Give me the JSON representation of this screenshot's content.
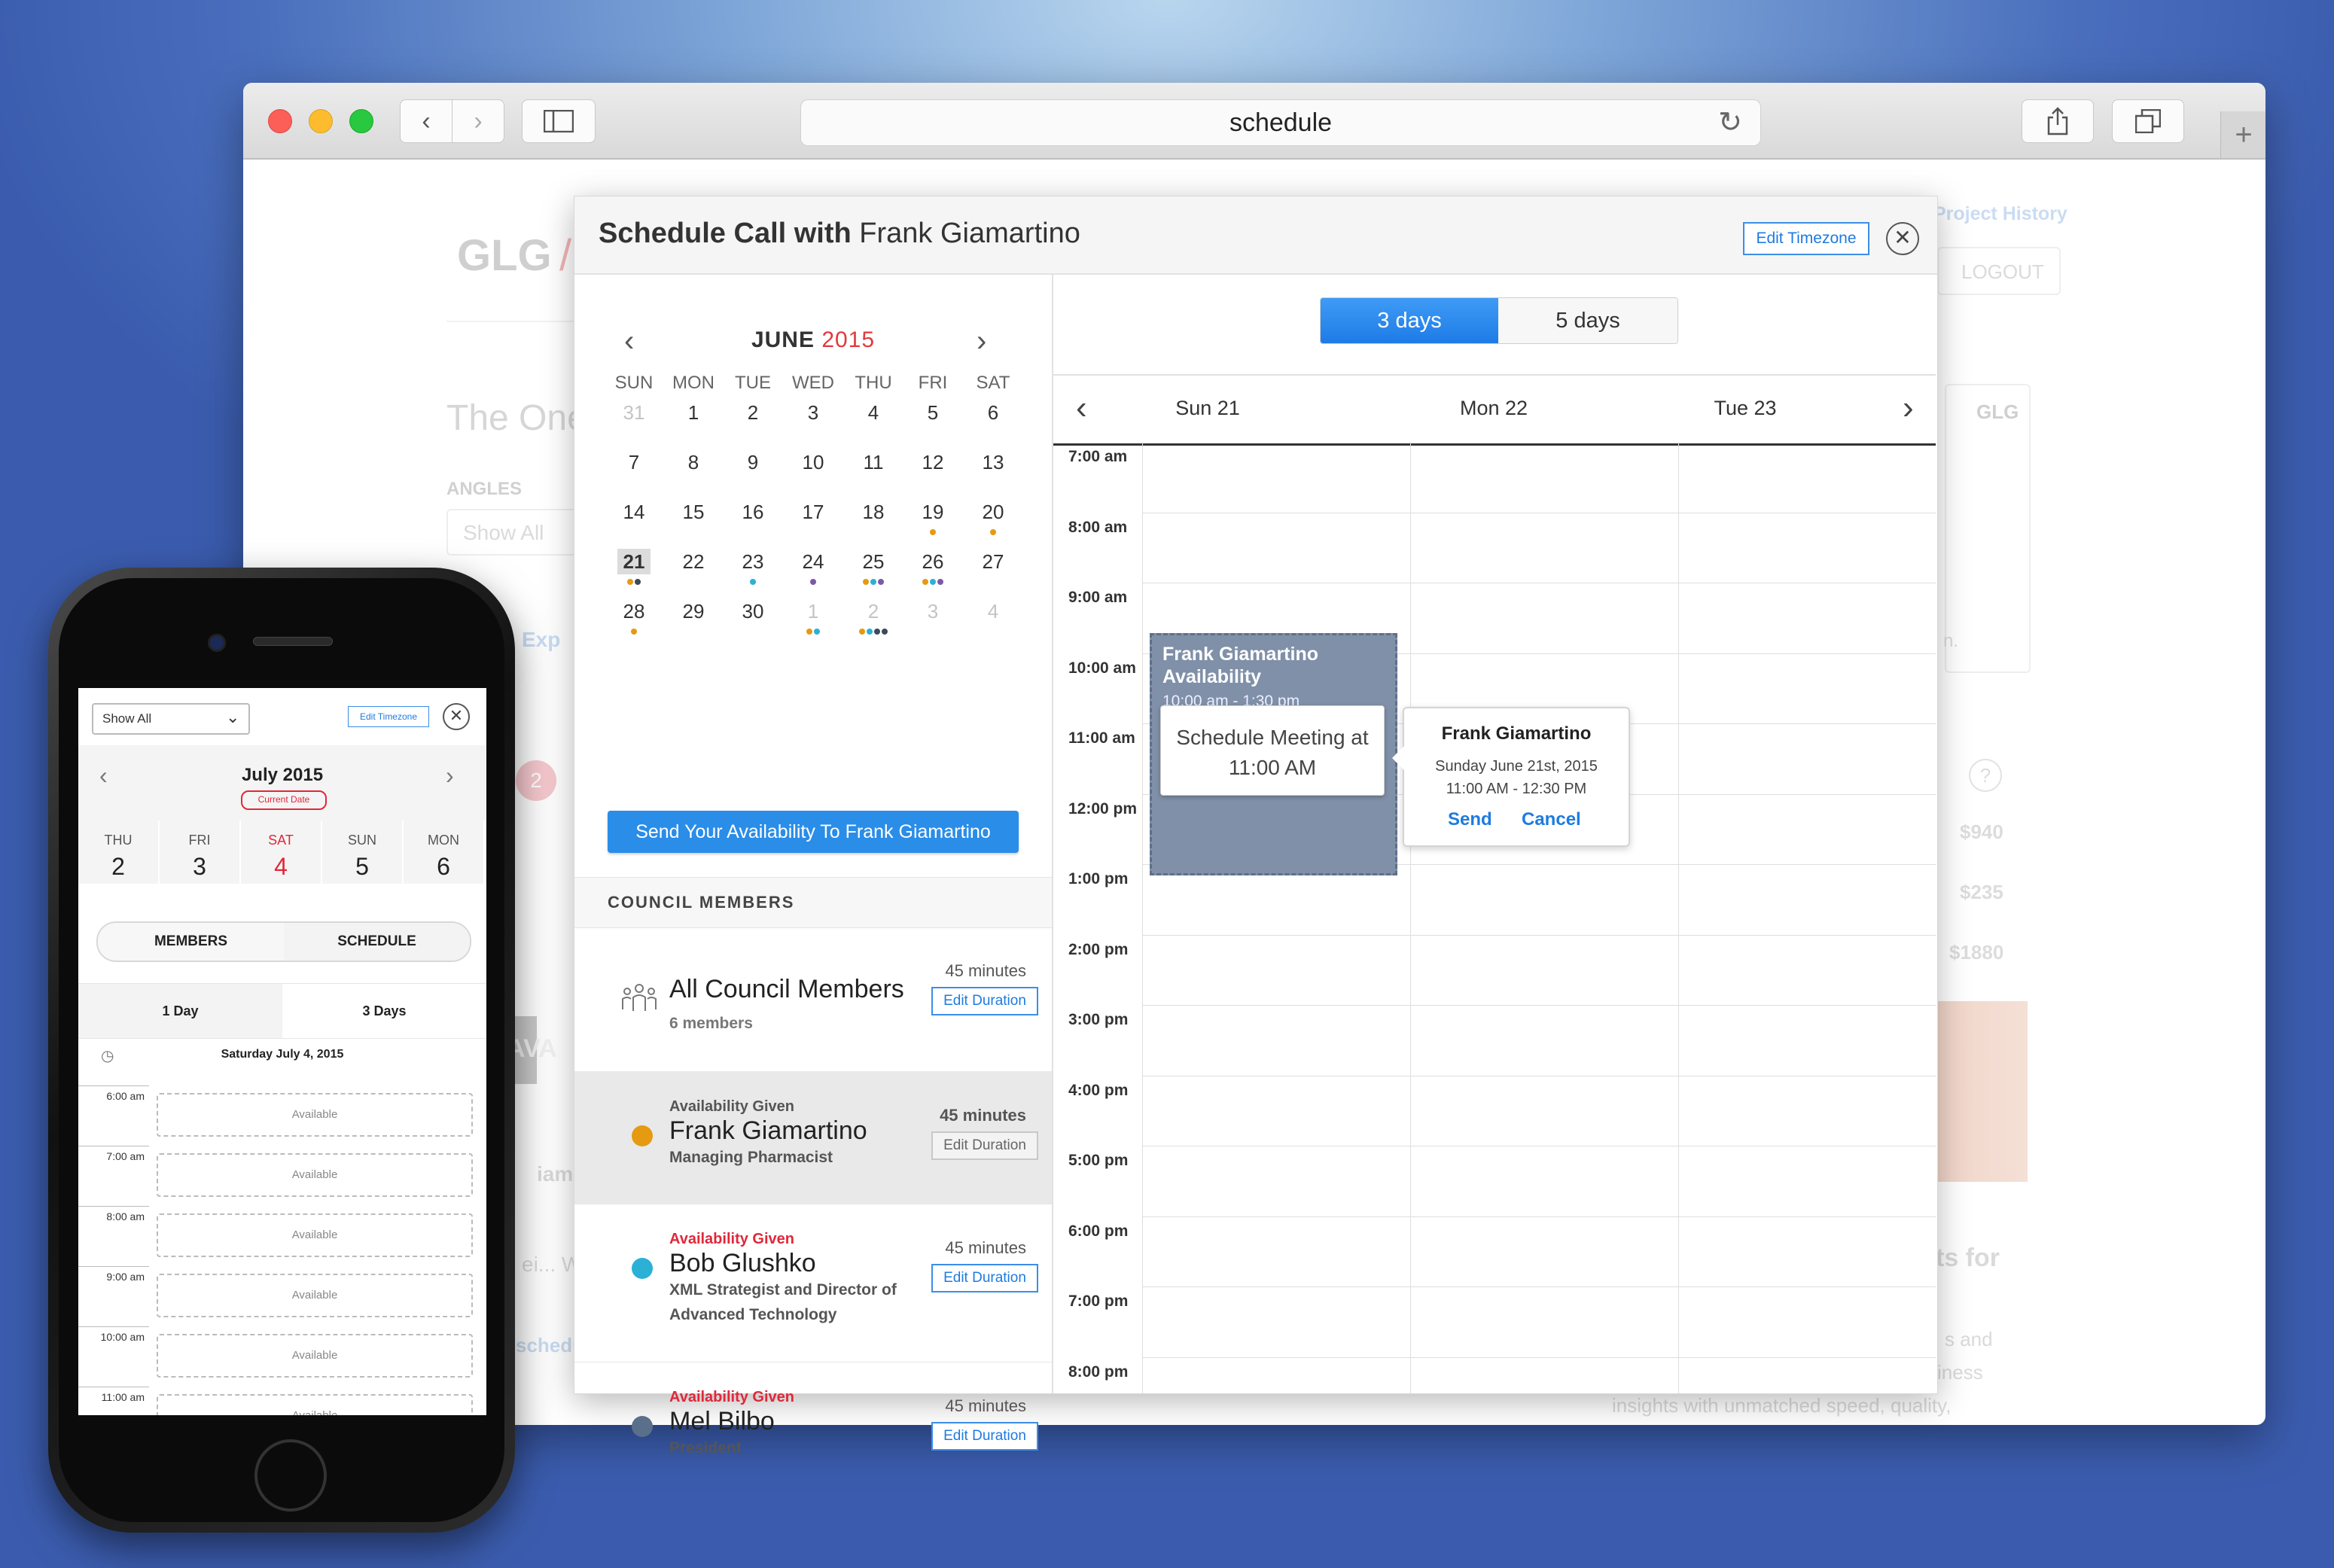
{
  "browser": {
    "address": "schedule"
  },
  "background_page": {
    "logo": "GLG",
    "slash": "/",
    "headline": "The One",
    "angles_label": "ANGLES",
    "angles_select": "Show All",
    "project_history": "Project History",
    "logout": "LOGOUT",
    "gl_badge": "GLG",
    "price_1": "$940",
    "price_2": "$235",
    "price_3": "$1880",
    "ghost_badge": "2",
    "ghost_ava": "AVA",
    "ghost_exp": "Exp",
    "ghost_name": "iamin",
    "ghost_sched": "schedul",
    "ghost_dots": "ei... W",
    "ghost_for": "ts for",
    "ghost_text1": "s and",
    "ghost_text2": "iness",
    "ghost_text3": "insights with unmatched speed, quality,",
    "ghost_dot_n": "n."
  },
  "modal": {
    "title_prefix": "Schedule Call with",
    "title_name": "Frank Giamartino",
    "edit_timezone": "Edit Timezone",
    "month": "JUNE",
    "year": "2015",
    "weekdays": [
      "SUN",
      "MON",
      "TUE",
      "WED",
      "THU",
      "FRI",
      "SAT"
    ],
    "weeks": [
      [
        "31",
        "1",
        "2",
        "3",
        "4",
        "5",
        "6"
      ],
      [
        "7",
        "8",
        "9",
        "10",
        "11",
        "12",
        "13"
      ],
      [
        "14",
        "15",
        "16",
        "17",
        "18",
        "19",
        "20"
      ],
      [
        "21",
        "22",
        "23",
        "24",
        "25",
        "26",
        "27"
      ],
      [
        "28",
        "29",
        "30",
        "1",
        "2",
        "3",
        "4"
      ]
    ],
    "selected_day": "21",
    "send_availability": "Send Your Availability To Frank Giamartino",
    "council_members_label": "COUNCIL MEMBERS",
    "members": [
      {
        "status": "",
        "name": "All Council Members",
        "role": "6 members",
        "minutes": "45 minutes",
        "button": "Edit Duration"
      },
      {
        "status": "Availability Given",
        "name": "Frank Giamartino",
        "role": "Managing Pharmacist",
        "minutes": "45 minutes",
        "button": "Edit Duration"
      },
      {
        "status": "Availability Given",
        "name": "Bob Glushko",
        "role": "XML Strategist and Director of Advanced Technology",
        "minutes": "45 minutes",
        "button": "Edit Duration"
      },
      {
        "status": "Availability Given",
        "name": "Mel Bilbo",
        "role": "President",
        "minutes": "45 minutes",
        "button": "Edit Duration"
      }
    ],
    "member_dot_colors": [
      "#e59a12",
      "#2bb0d6",
      "#5a6f8a"
    ],
    "calendar": {
      "toggle_3days": "3 days",
      "toggle_5days": "5 days",
      "active_toggle": "3 days",
      "days": [
        "Sun 21",
        "Mon 22",
        "Tue 23"
      ],
      "times": [
        "7:00 am",
        "8:00 am",
        "9:00 am",
        "10:00 am",
        "11:00 am",
        "12:00 pm",
        "1:00 pm",
        "2:00 pm",
        "3:00 pm",
        "4:00 pm",
        "5:00 pm",
        "6:00 pm",
        "7:00 pm",
        "8:00 pm"
      ],
      "availability_title": "Frank Giamartino Availability",
      "availability_time": "10:00 am - 1:30 pm",
      "tooltip_line1": "Schedule Meeting at",
      "tooltip_line2": "11:00 AM",
      "popover_name": "Frank Giamartino",
      "popover_date": "Sunday June 21st, 2015",
      "popover_time": "11:00 AM - 12:30 PM",
      "popover_send": "Send",
      "popover_cancel": "Cancel"
    }
  },
  "phone": {
    "filter": "Show All",
    "edit_timezone": "Edit Timezone",
    "month": "July 2015",
    "current_date_badge": "Current Date",
    "days": [
      {
        "dow": "THU",
        "num": "2"
      },
      {
        "dow": "FRI",
        "num": "3"
      },
      {
        "dow": "SAT",
        "num": "4"
      },
      {
        "dow": "SUN",
        "num": "5"
      },
      {
        "dow": "MON",
        "num": "6"
      }
    ],
    "tab_members": "MEMBERS",
    "tab_schedule": "SCHEDULE",
    "range_1day": "1 Day",
    "range_3days": "3 Days",
    "date_label": "Saturday July 4, 2015",
    "times": [
      "6:00 am",
      "7:00 am",
      "8:00 am",
      "9:00 am",
      "10:00 am",
      "11:00 am"
    ],
    "slot_label": "Available"
  },
  "colors": {
    "accent_blue": "#2a8de8",
    "accent_red": "#e2393d",
    "dot_orange": "#e59a12",
    "dot_teal": "#2bb0d6",
    "dot_purple": "#7a5aa6",
    "dot_dark": "#3c4a5a"
  }
}
